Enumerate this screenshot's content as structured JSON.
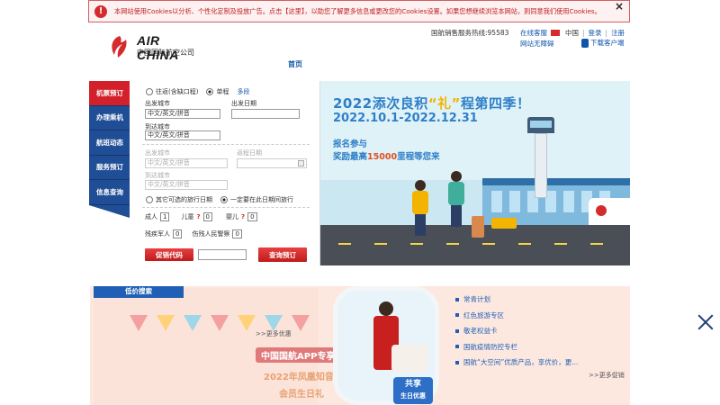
{
  "cookie": {
    "message": "本网站使用Cookies以分析、个性化定制及投放广告。点击【这里】，以助您了解更多信息或更改您的Cookies设置。如果您想继续浏览本网站，则同意我们使用Cookies。",
    "close": "×"
  },
  "header": {
    "logo_en": "AIR CHINA",
    "logo_cn": "中国国际航空公司",
    "hotline": "国航销售服务热线:95583",
    "online_service": "在线客服",
    "language": "中国",
    "login": "登录",
    "register": "注册",
    "barrier_free": "网站无障碍",
    "download_app": "下载客户端",
    "nav_home": "首页"
  },
  "sidebar": {
    "items": [
      {
        "label": "机票预订"
      },
      {
        "label": "办理乘机"
      },
      {
        "label": "航班动态"
      },
      {
        "label": "服务预订"
      },
      {
        "label": "信息查询"
      }
    ]
  },
  "booking": {
    "trip_roundtrip": "往返(含缺口程)",
    "trip_oneway": "单程",
    "trip_multi": "多段",
    "from_label": "出发城市",
    "date_label": "出发日期",
    "from_placeholder": "中文/英文/拼音",
    "to_label": "到达城市",
    "to_placeholder": "中文/英文/拼音",
    "from2_label": "出发城市",
    "from2_placeholder": "中文/英文/拼音",
    "return_label": "返程日期",
    "to2_label": "到达城市",
    "to2_placeholder": "中文/英文/拼音",
    "flex_dates": "其它可选的旅行日期",
    "fixed_dates": "一定要在此日期间旅行",
    "adult_label": "成人",
    "adult_value": "1",
    "child_label": "儿童",
    "child_value": "0",
    "infant_label": "婴儿",
    "infant_value": "0",
    "military_label": "残疾军人",
    "military_value": "0",
    "police_label": "伤残人民警察",
    "police_value": "0",
    "promo_label": "促销代码",
    "search_button": "查询预订"
  },
  "banner": {
    "title_pre": "2022添次良积",
    "title_hl": "“礼”",
    "title_post": "程第四季！",
    "dates": "2022.10.1-2022.12.31",
    "line1": "报名参与",
    "line2_pre": "奖励最高",
    "line2_num": "15000",
    "line2_post": "里程等您来"
  },
  "deals": {
    "title": "低价搜索",
    "more": ">>更多优惠",
    "app_title": "中国国航APP专享",
    "app_line2": "2022年凤凰知音",
    "app_line3": "会员生日礼",
    "badge_line1": "共享",
    "badge_line2": "生日优惠"
  },
  "news": {
    "items": [
      {
        "label": "常青计划"
      },
      {
        "label": "红色旅游专区"
      },
      {
        "label": "敬老权益卡"
      },
      {
        "label": "国航疫情防控专栏"
      },
      {
        "label": "国航“大空间”优质产品，享优价，更..."
      }
    ],
    "more": ">>更多促销"
  }
}
